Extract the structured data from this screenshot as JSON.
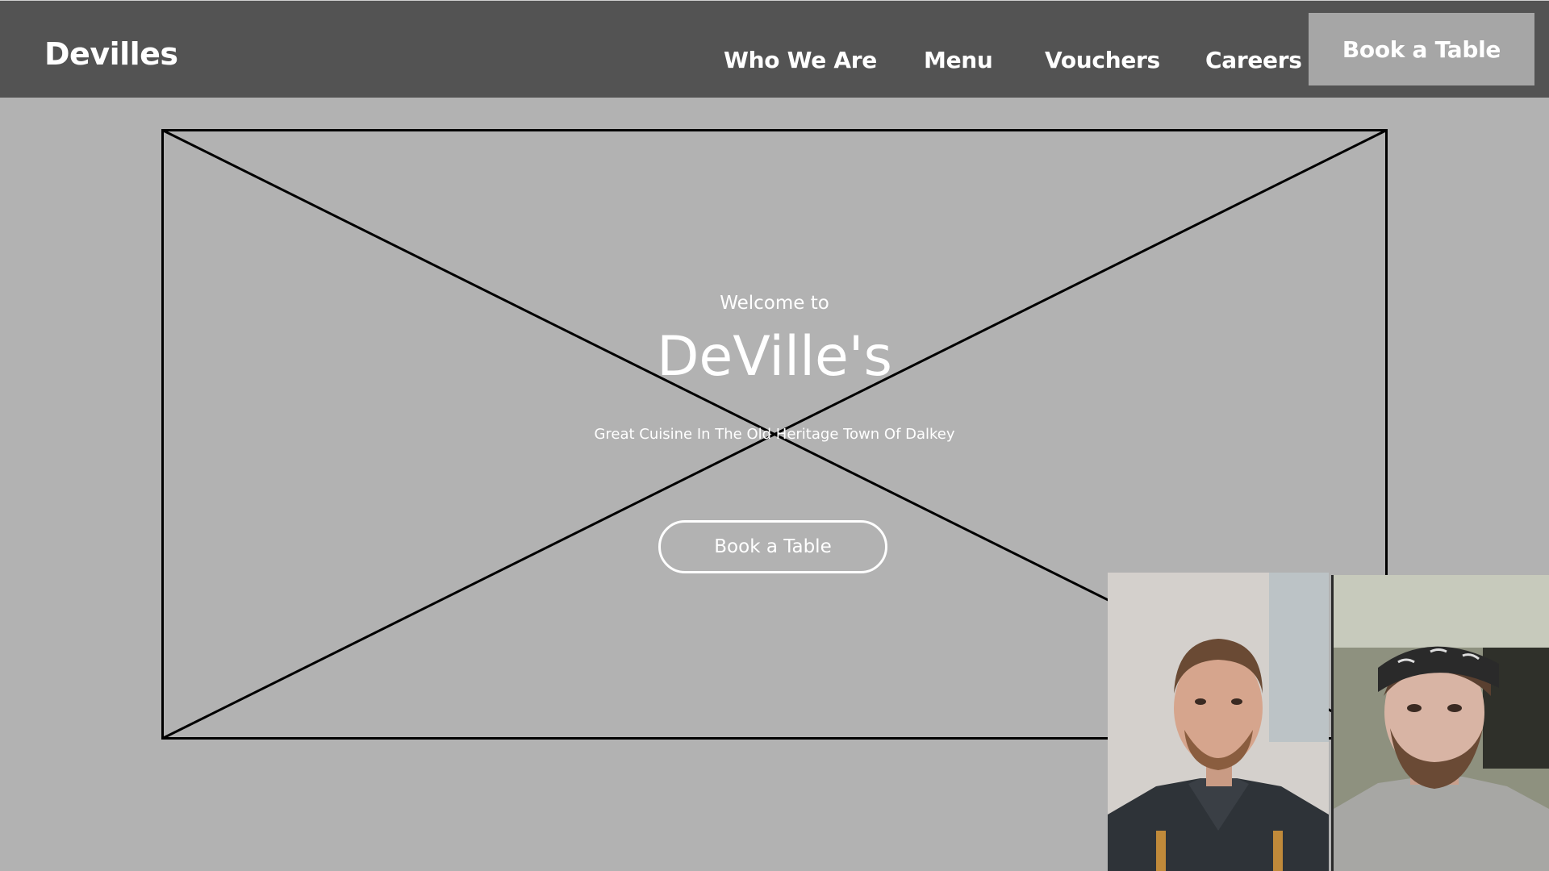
{
  "navbar": {
    "brand": "Devilles",
    "links": [
      {
        "label": "Who We Are"
      },
      {
        "label": "Menu"
      },
      {
        "label": "Vouchers"
      },
      {
        "label": "Careers"
      }
    ],
    "cta_label": "Book a Table",
    "background": "#535353"
  },
  "hero": {
    "welcome": "Welcome to",
    "title": "DeVille's",
    "tagline": "Great Cuisine In The Old Heritage Town Of Dalkey",
    "cta_label": "Book a Table",
    "placeholder": "image-placeholder"
  },
  "colors": {
    "page_background": "#b2b2b2",
    "nav_cta_background": "#a6a6a6",
    "text": "#ffffff",
    "placeholder_stroke": "#000000"
  },
  "video_call": {
    "participants": [
      {
        "icon": "participant-1-video"
      },
      {
        "icon": "participant-2-video"
      }
    ]
  }
}
